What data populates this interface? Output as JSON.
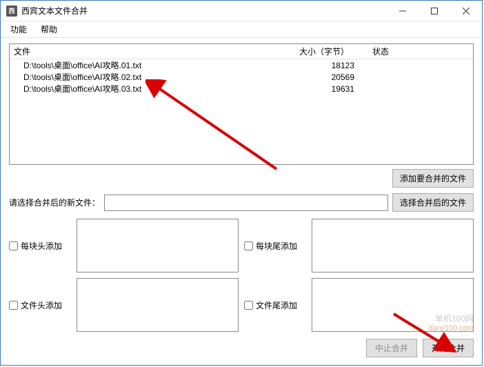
{
  "window": {
    "title": "西宾文本文件合并"
  },
  "menu": {
    "items": [
      "功能",
      "帮助"
    ]
  },
  "filelist": {
    "headers": {
      "file": "文件",
      "size": "大小（字节）",
      "status": "状态"
    },
    "rows": [
      {
        "file": "D:\\tools\\桌面\\office\\AI攻略.01.txt",
        "size": "18123",
        "status": ""
      },
      {
        "file": "D:\\tools\\桌面\\office\\AI攻略.02.txt",
        "size": "20569",
        "status": ""
      },
      {
        "file": "D:\\tools\\桌面\\office\\AI攻略.03.txt",
        "size": "19631",
        "status": ""
      }
    ]
  },
  "buttons": {
    "add_files": "添加要合并的文件",
    "choose_output": "选择合并后的文件",
    "stop": "中止合并",
    "start": "开始合并"
  },
  "output": {
    "label": "请选择合并后的新文件：",
    "value": ""
  },
  "options": {
    "block_head_add": "每块头添加",
    "block_tail_add": "每块尾添加",
    "file_head_add": "文件头添加",
    "file_tail_add": "文件尾添加"
  },
  "watermark": {
    "line1": "单机100网",
    "line2": "danji100.com"
  }
}
